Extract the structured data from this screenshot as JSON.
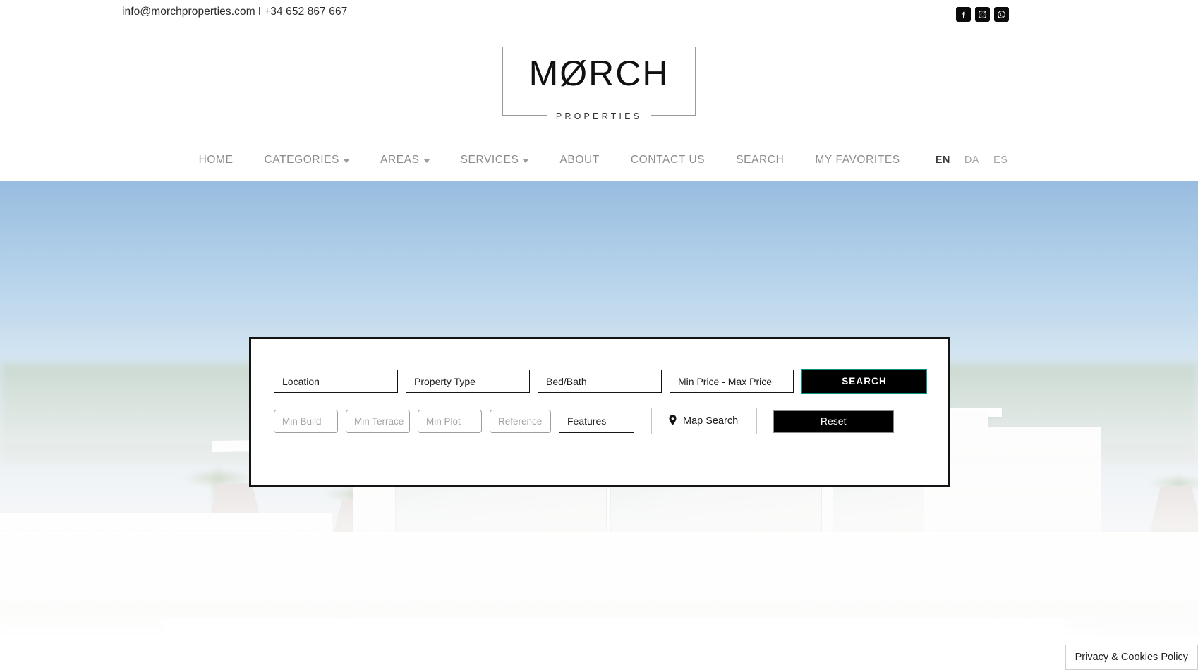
{
  "topbar": {
    "email": "info@morchproperties.com",
    "separator": "I",
    "phone": "+34 652 867 667",
    "social": [
      {
        "name": "facebook",
        "label": "Facebook"
      },
      {
        "name": "instagram",
        "label": "Instagram"
      },
      {
        "name": "whatsapp",
        "label": "WhatsApp"
      }
    ]
  },
  "logo": {
    "word": "MØRCH",
    "subtitle": "PROPERTIES"
  },
  "nav": {
    "items": [
      {
        "label": "HOME",
        "has_dropdown": false
      },
      {
        "label": "CATEGORIES",
        "has_dropdown": true
      },
      {
        "label": "AREAS",
        "has_dropdown": true
      },
      {
        "label": "SERVICES",
        "has_dropdown": true
      },
      {
        "label": "ABOUT",
        "has_dropdown": false
      },
      {
        "label": "CONTACT US",
        "has_dropdown": false
      },
      {
        "label": "SEARCH",
        "has_dropdown": false
      },
      {
        "label": "MY FAVORITES",
        "has_dropdown": false
      }
    ],
    "languages": [
      {
        "code": "EN",
        "active": true
      },
      {
        "code": "DA",
        "active": false
      },
      {
        "code": "ES",
        "active": false
      }
    ]
  },
  "search_form": {
    "row1": {
      "location": "Location",
      "property_type": "Property Type",
      "bed_bath": "Bed/Bath",
      "price": "Min Price - Max Price",
      "search_button": "SEARCH"
    },
    "row2": {
      "min_build": "Min Build",
      "min_terrace": "Min Terrace",
      "min_plot": "Min Plot",
      "reference": "Reference",
      "features": "Features",
      "map_search": "Map Search",
      "reset_button": "Reset"
    }
  },
  "privacy": {
    "label": "Privacy & Cookies Policy"
  },
  "colors": {
    "accent_teal": "#0c8f84",
    "button_black": "#000000",
    "nav_gray": "#8c8c8c",
    "placeholder_gray": "#a3a3a3",
    "panel_border": "#141414"
  }
}
